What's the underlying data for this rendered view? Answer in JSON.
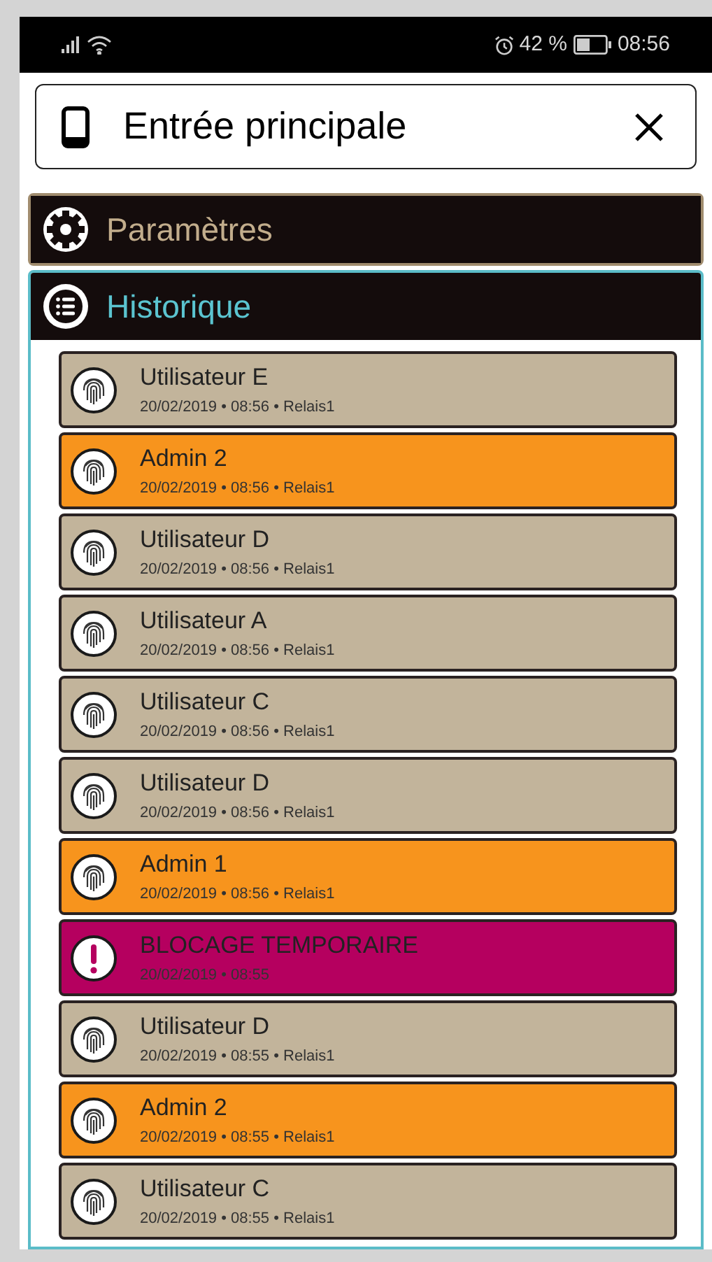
{
  "status_bar": {
    "battery": "42 %",
    "time": "08:56"
  },
  "header": {
    "title": "Entrée principale"
  },
  "sections": [
    {
      "title": "Paramètres",
      "kind": "settings",
      "expanded": false
    },
    {
      "title": "Historique",
      "kind": "history",
      "expanded": true,
      "entries": [
        {
          "kind": "user",
          "name": "Utilisateur E",
          "details": "20/02/2019 • 08:56 • Relais1"
        },
        {
          "kind": "admin",
          "name": "Admin 2",
          "details": "20/02/2019 • 08:56 • Relais1"
        },
        {
          "kind": "user",
          "name": "Utilisateur D",
          "details": "20/02/2019 • 08:56 • Relais1"
        },
        {
          "kind": "user",
          "name": "Utilisateur A",
          "details": "20/02/2019 • 08:56 • Relais1"
        },
        {
          "kind": "user",
          "name": "Utilisateur C",
          "details": "20/02/2019 • 08:56 • Relais1"
        },
        {
          "kind": "user",
          "name": "Utilisateur D",
          "details": "20/02/2019 • 08:56 • Relais1"
        },
        {
          "kind": "admin",
          "name": "Admin 1",
          "details": "20/02/2019 • 08:56 • Relais1"
        },
        {
          "kind": "alert",
          "name": "BLOCAGE TEMPORAIRE",
          "details": "20/02/2019 • 08:55"
        },
        {
          "kind": "user",
          "name": "Utilisateur D",
          "details": "20/02/2019 • 08:55 • Relais1"
        },
        {
          "kind": "admin",
          "name": "Admin 2",
          "details": "20/02/2019 • 08:55 • Relais1"
        },
        {
          "kind": "user",
          "name": "Utilisateur C",
          "details": "20/02/2019 • 08:55 • Relais1"
        }
      ]
    }
  ]
}
